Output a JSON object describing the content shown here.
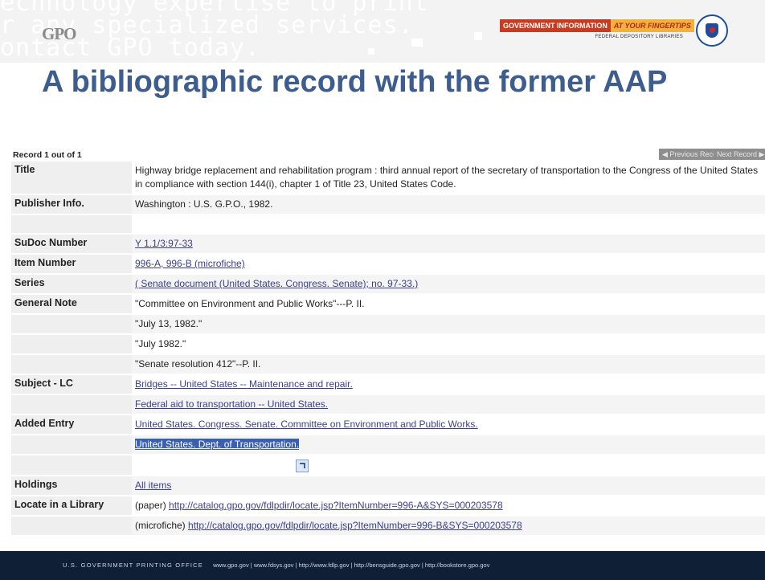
{
  "header": {
    "ghost_lines": [
      "echnology expertise to print",
      "r any specialized services.",
      "ontact GPO today."
    ],
    "logo_text": "GPO",
    "banner_main": "GOVERNMENT INFORMATION",
    "banner_accent": "AT YOUR FINGERTIPS",
    "banner_sub": "FEDERAL DEPOSITORY LIBRARIES",
    "seal_icon": "fdlp-eagle-seal-icon"
  },
  "slide_title": "A bibliographic record with the former AAP",
  "record": {
    "count_text": "Record 1 out of 1",
    "prev_label": "◀ Previous Record",
    "next_label": "Next Record ▶",
    "rows": [
      {
        "label": "Title",
        "value": "Highway bridge replacement and rehabilitation program : third annual report of the secretary of transportation to the Congress of the United States in compliance with section 144(i), chapter 1 of Title 23, United States Code."
      },
      {
        "label": "Publisher Info.",
        "value": "Washington : U.S. G.P.O., 1982."
      },
      {
        "label": "",
        "value": ""
      },
      {
        "label": "SuDoc Number",
        "value": "Y 1.1/3:97-33"
      },
      {
        "label": "Item Number",
        "value": "996-A, 996-B (microfiche)"
      },
      {
        "label": "Series",
        "value": "( Senate document (United States. Congress. Senate); no. 97-33.)"
      },
      {
        "label": "General Note",
        "value": "\"Committee on Environment and Public Works\"---P. II."
      },
      {
        "label": "",
        "value": "\"July 13, 1982.\""
      },
      {
        "label": "",
        "value": "\"July 1982.\""
      },
      {
        "label": "",
        "value": "\"Senate resolution 412\"--P. II."
      },
      {
        "label": "Subject - LC",
        "value": "Bridges -- United States -- Maintenance and repair."
      },
      {
        "label": "",
        "value": "Federal aid to transportation -- United States."
      },
      {
        "label": "Added Entry",
        "value": "United States. Congress. Senate. Committee on Environment and Public Works."
      },
      {
        "label": "",
        "value": "United States. Dept. of Transportation."
      },
      {
        "label": "",
        "value": ""
      },
      {
        "label": "Holdings",
        "value": "All items"
      },
      {
        "label": "Locate in a Library",
        "prefix": "(paper) ",
        "value": "http://catalog.gpo.gov/fdlpdir/locate.jsp?ItemNumber=996-A&SYS=000203578"
      },
      {
        "label": "",
        "prefix": "(microfiche) ",
        "value": "http://catalog.gpo.gov/fdlpdir/locate.jsp?ItemNumber=996-B&SYS=000203578"
      }
    ]
  },
  "footer": {
    "agency": "U.S. GOVERNMENT PRINTING OFFICE",
    "links_text": "www.gpo.gov  |  www.fdsys.gov  |  http://www.fdlp.gov  |  http://bensguide.gpo.gov  |  http://bookstore.gpo.gov"
  }
}
